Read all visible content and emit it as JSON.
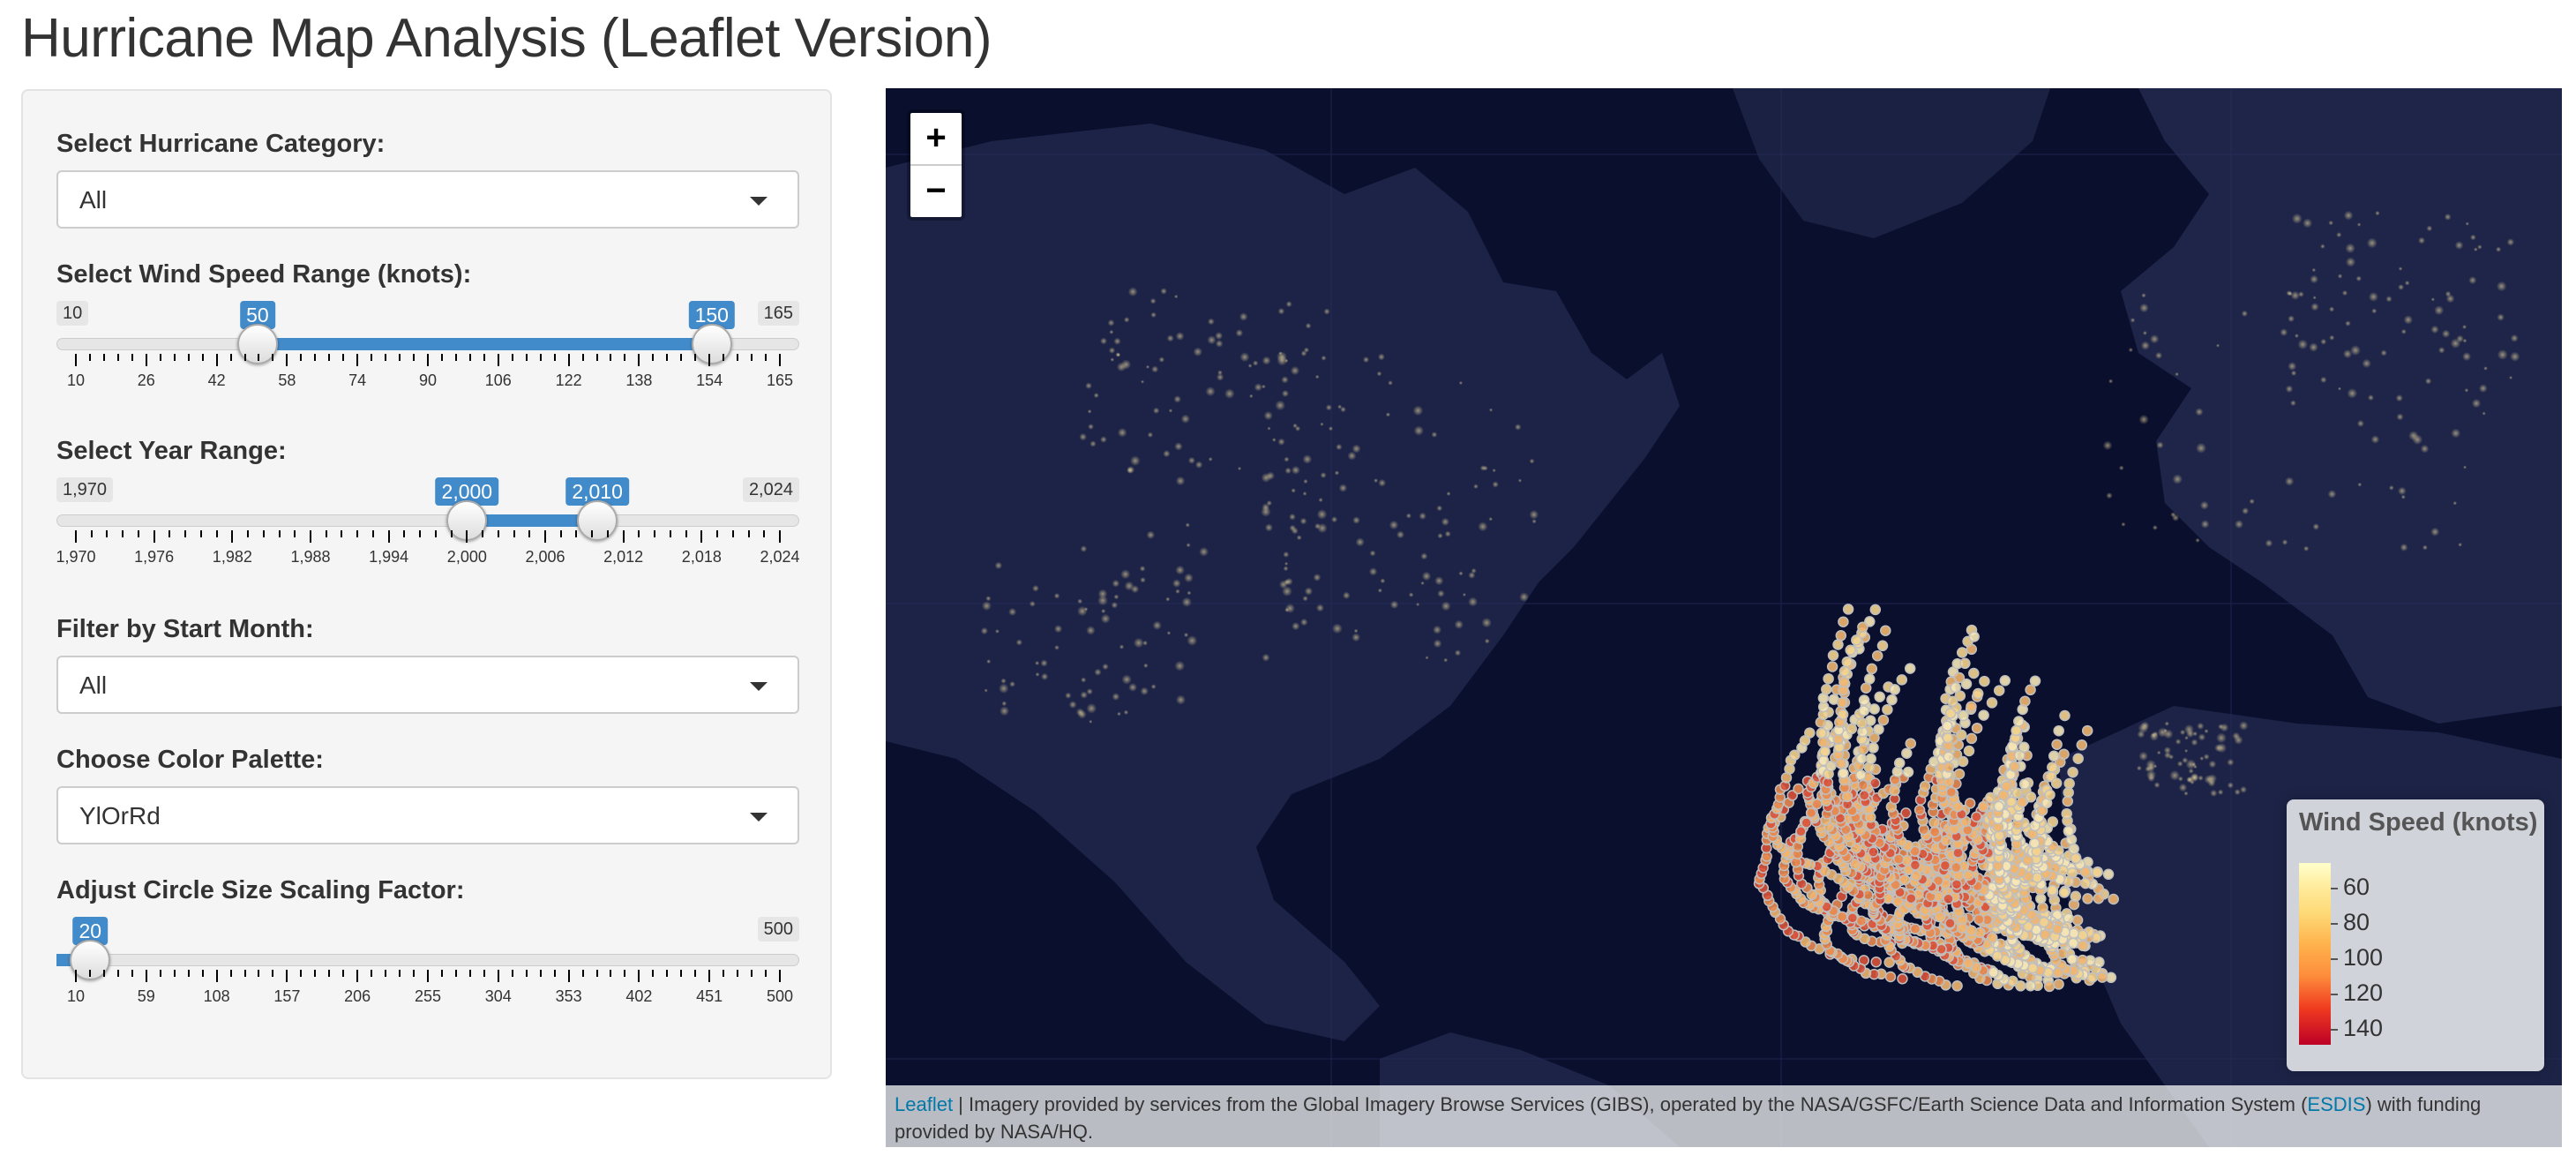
{
  "title": "Hurricane Map Analysis (Leaflet Version)",
  "sidebar": {
    "category": {
      "label": "Select Hurricane Category:",
      "value": "All"
    },
    "wind": {
      "label": "Select Wind Speed Range (knots):",
      "min": 10,
      "max": 165,
      "from": 50,
      "to": 150,
      "min_text": "10",
      "max_text": "165",
      "from_text": "50",
      "to_text": "150",
      "ticks": [
        "10",
        "26",
        "42",
        "58",
        "74",
        "90",
        "106",
        "122",
        "138",
        "154",
        "165"
      ]
    },
    "year": {
      "label": "Select Year Range:",
      "min": 1970,
      "max": 2024,
      "from": 2000,
      "to": 2010,
      "min_text": "1,970",
      "max_text": "2,024",
      "from_text": "2,000",
      "to_text": "2,010",
      "ticks": [
        "1,970",
        "1,976",
        "1,982",
        "1,988",
        "1,994",
        "2,000",
        "2,006",
        "2,012",
        "2,018",
        "2,024"
      ]
    },
    "month": {
      "label": "Filter by Start Month:",
      "value": "All"
    },
    "palette": {
      "label": "Choose Color Palette:",
      "value": "YlOrRd"
    },
    "scale": {
      "label": "Adjust Circle Size Scaling Factor:",
      "min": 10,
      "max": 500,
      "value": 20,
      "min_text": "10",
      "max_text": "500",
      "value_text": "20",
      "ticks": [
        "10",
        "59",
        "108",
        "157",
        "206",
        "255",
        "304",
        "353",
        "402",
        "451",
        "500"
      ]
    }
  },
  "map": {
    "zoom_in": "+",
    "zoom_out": "−",
    "legend": {
      "title": "Wind Speed (knots)",
      "labels": [
        "60",
        "80",
        "100",
        "120",
        "140"
      ]
    },
    "attribution": {
      "leaflet": "Leaflet",
      "text_before": " | Imagery provided by services from the Global Imagery Browse Services (GIBS), operated by the NASA/GSFC/Earth Science Data and Information System (",
      "esdis": "ESDIS",
      "text_after": ") with funding provided by NASA/HQ."
    }
  },
  "colors": {
    "accent": "#428bca",
    "ocean": "#0b1030",
    "land": "#1b2244",
    "low_wind": "#f4e3b0",
    "high_wind": "#d9533a"
  }
}
